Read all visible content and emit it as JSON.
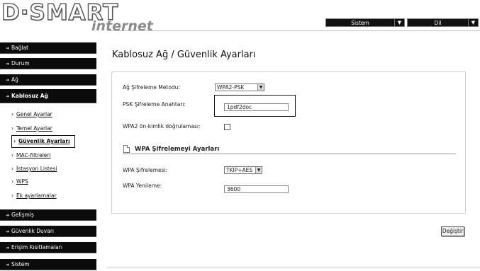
{
  "logo": {
    "main": "D·SMART",
    "sub": "internet"
  },
  "top_selects": {
    "system": {
      "value": "Sistem"
    },
    "language": {
      "value": "Dil"
    }
  },
  "sidebar": {
    "items": [
      {
        "label": "Bağlat"
      },
      {
        "label": "Durum"
      },
      {
        "label": "Ağ"
      },
      {
        "label": "Kablosuz Ağ"
      },
      {
        "label": "Gelişmiş"
      },
      {
        "label": "Güvenlik Duvarı"
      },
      {
        "label": "Erişim Kısıtlamaları"
      },
      {
        "label": "Sistem"
      }
    ],
    "sub_items": [
      {
        "label": "Genel Ayarlar"
      },
      {
        "label": "Temel Ayarlar"
      },
      {
        "label": "Güvenlik Ayarları"
      },
      {
        "label": "MAC-filtreleri"
      },
      {
        "label": "İstasyon Listesi"
      },
      {
        "label": "WPS"
      },
      {
        "label": "Ek ayarlamalar"
      }
    ]
  },
  "main": {
    "title": "Kablosuz Ağ  / Güvenlik Ayarları",
    "fields": {
      "method_label": "Ağ Şifreleme Metodu:",
      "method_value": "WPA2-PSK",
      "psk_label": "PSK Şifreleme Anahtarı:",
      "psk_value": "1pdf2doc",
      "preauth_label": "WPA2 ön-kimlik doğrulaması:"
    },
    "section": {
      "title": "WPA Şifrelemeyi Ayarları",
      "encryption_label": "WPA Şifrelemesi:",
      "encryption_value": "TKIP+AES",
      "renewal_label": "WPA Yenileme:",
      "renewal_value": "3600"
    },
    "button_label": "Değiştir"
  }
}
